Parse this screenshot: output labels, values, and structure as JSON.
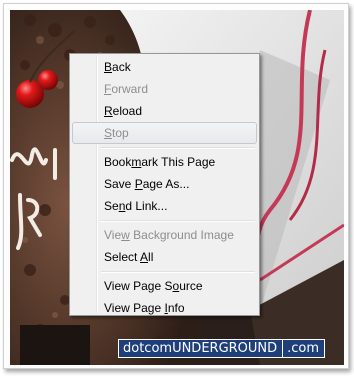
{
  "context_menu": {
    "items": [
      {
        "label": "Back",
        "mnemonic": "B",
        "state": "enabled"
      },
      {
        "label": "Forward",
        "mnemonic": "F",
        "state": "disabled"
      },
      {
        "label": "Reload",
        "mnemonic": "R",
        "state": "enabled"
      },
      {
        "label": "Stop",
        "mnemonic": "S",
        "state": "disabled-hover"
      },
      {
        "label": "Bookmark This Page",
        "mnemonic": "m",
        "state": "enabled"
      },
      {
        "label": "Save Page As...",
        "mnemonic": "P",
        "state": "enabled"
      },
      {
        "label": "Send Link...",
        "mnemonic": "n",
        "state": "enabled"
      },
      {
        "label": "View Background Image",
        "mnemonic": "w",
        "state": "disabled"
      },
      {
        "label": "Select All",
        "mnemonic": "A",
        "state": "enabled"
      },
      {
        "label": "View Page Source",
        "mnemonic": "o",
        "state": "enabled"
      },
      {
        "label": "View Page Info",
        "mnemonic": "I",
        "state": "enabled"
      }
    ]
  },
  "watermark": {
    "main": "dotcomUNDERGROUND",
    "tld": ".com"
  },
  "colors": {
    "menu_background": "#f0f0f0",
    "menu_border": "#979797",
    "disabled_text": "#8d8d8d",
    "hover_border": "#c3c9d1",
    "watermark_background": "#1f3f7a"
  }
}
